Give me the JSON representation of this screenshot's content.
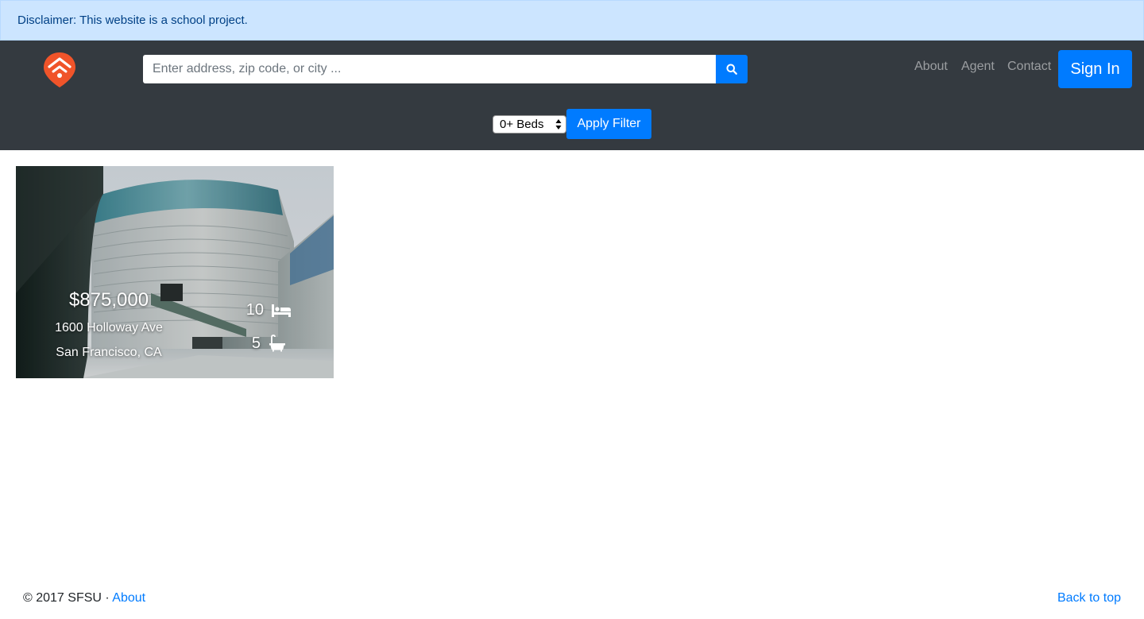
{
  "disclaimer": {
    "text": "Disclaimer: This website is a school project."
  },
  "header": {
    "logo_icon": "home-pin-logo-icon",
    "search": {
      "placeholder": "Enter address, zip code, or city ...",
      "value": "",
      "button_icon": "search-icon"
    },
    "nav": [
      {
        "label": "About"
      },
      {
        "label": "Agent"
      },
      {
        "label": "Contact"
      }
    ],
    "signin_label": "Sign In",
    "filter": {
      "beds_selected": "0+ Beds",
      "apply_label": "Apply Filter"
    }
  },
  "listings": [
    {
      "price": "$875,000",
      "street": "1600 Holloway Ave",
      "city": "San Francisco, CA",
      "beds": "10",
      "baths": "5",
      "bed_icon": "bed-icon",
      "bath_icon": "bath-icon"
    }
  ],
  "footer": {
    "copyright": "© 2017 SFSU · ",
    "about_label": "About",
    "back_to_top": "Back to top"
  },
  "colors": {
    "navbar": "#343a40",
    "primary": "#007bff",
    "disclaimer_bg": "#cce5ff",
    "logo": "#f0542a"
  }
}
